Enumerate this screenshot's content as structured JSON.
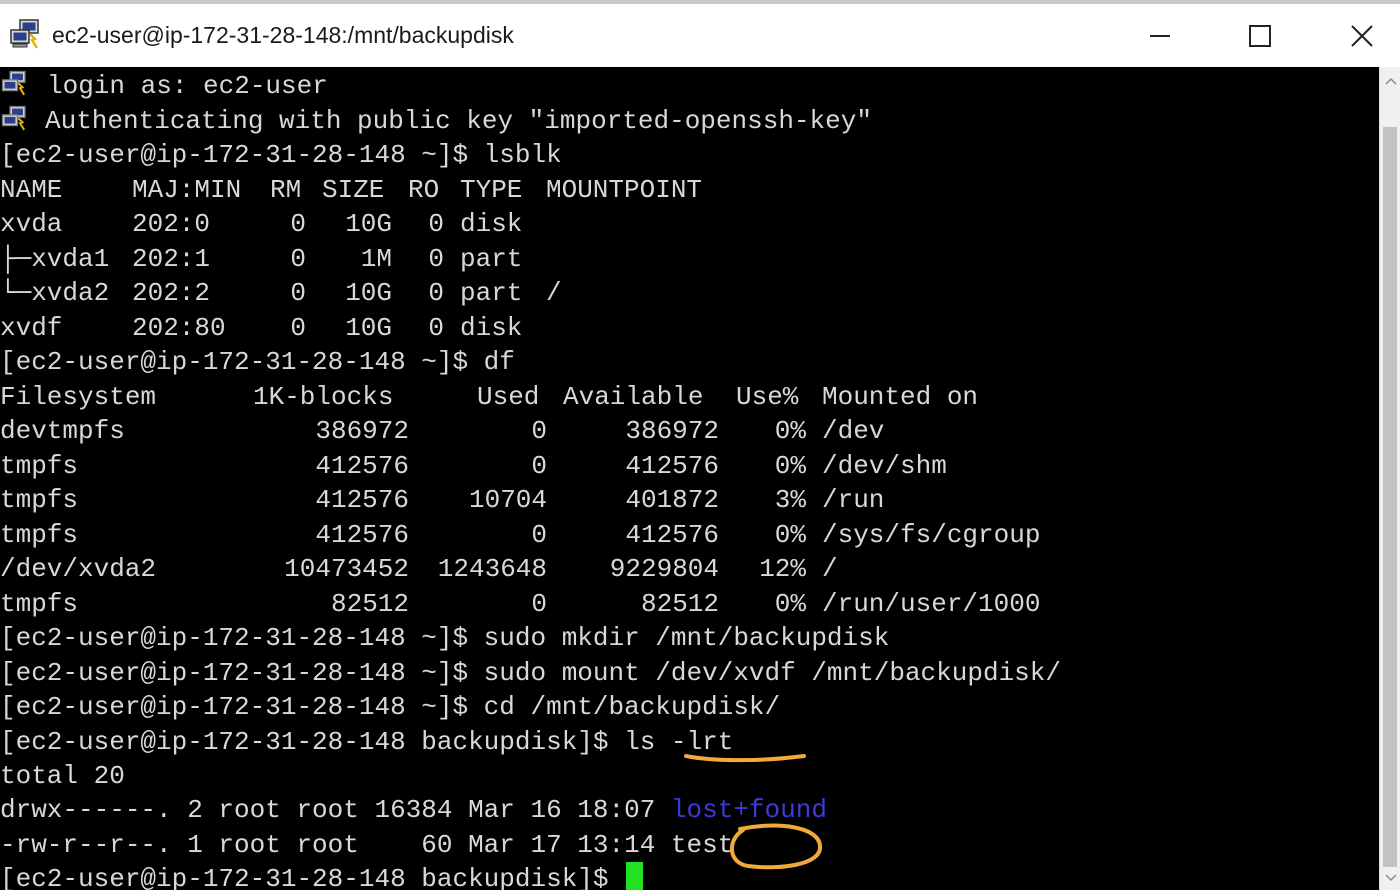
{
  "window": {
    "title": "ec2-user@ip-172-31-28-148:/mnt/backupdisk",
    "icon": "putty-computers-icon",
    "controls": [
      "minimize-icon",
      "maximize-icon",
      "close-icon"
    ]
  },
  "colors": {
    "terminal_bg": "#000000",
    "terminal_fg": "#d8d8d8",
    "directory": "#3b3bd6",
    "cursor": "#22e022",
    "annotation": "#f0a93a"
  },
  "terminal": {
    "login": {
      "login_text": "login as: ec2-user",
      "auth_text": "Authenticating with public key \"imported-openssh-key\""
    },
    "lsblk_cmd": "[ec2-user@ip-172-31-28-148 ~]$ lsblk",
    "lsblk": {
      "headers": [
        "NAME",
        "MAJ:MIN",
        "RM",
        "SIZE",
        "RO",
        "TYPE",
        "MOUNTPOINT"
      ],
      "rows": [
        [
          "xvda",
          "202:0",
          "0",
          "10G",
          "0",
          "disk",
          ""
        ],
        [
          "├─xvda1",
          "202:1",
          "0",
          "1M",
          "0",
          "part",
          ""
        ],
        [
          "└─xvda2",
          "202:2",
          "0",
          "10G",
          "0",
          "part",
          "/"
        ],
        [
          "xvdf",
          "202:80",
          "0",
          "10G",
          "0",
          "disk",
          ""
        ]
      ]
    },
    "df_cmd": "[ec2-user@ip-172-31-28-148 ~]$ df",
    "df": {
      "headers": [
        "Filesystem",
        "1K-blocks",
        "Used",
        "Available",
        "Use%",
        "Mounted on"
      ],
      "rows": [
        [
          "devtmpfs",
          "386972",
          "0",
          "386972",
          "0%",
          "/dev"
        ],
        [
          "tmpfs",
          "412576",
          "0",
          "412576",
          "0%",
          "/dev/shm"
        ],
        [
          "tmpfs",
          "412576",
          "10704",
          "401872",
          "3%",
          "/run"
        ],
        [
          "tmpfs",
          "412576",
          "0",
          "412576",
          "0%",
          "/sys/fs/cgroup"
        ],
        [
          "/dev/xvda2",
          "10473452",
          "1243648",
          "9229804",
          "12%",
          "/"
        ],
        [
          "tmpfs",
          "82512",
          "0",
          "82512",
          "0%",
          "/run/user/1000"
        ]
      ]
    },
    "mkdir_cmd": "[ec2-user@ip-172-31-28-148 ~]$ sudo mkdir /mnt/backupdisk",
    "mount_cmd": "[ec2-user@ip-172-31-28-148 ~]$ sudo mount /dev/xvdf /mnt/backupdisk/",
    "cd_cmd": "[ec2-user@ip-172-31-28-148 ~]$ cd /mnt/backupdisk/",
    "ls_prompt": "[ec2-user@ip-172-31-28-148 backupdisk]$ ",
    "ls_cmd": "ls -lrt",
    "total": "total 20",
    "ls": {
      "rows": [
        {
          "meta": "drwx------. 2 root root 16384 Mar 16 18:07 ",
          "name": "lost+found",
          "is_dir": true
        },
        {
          "meta": "-rw-r--r--. 1 root root    60 Mar 17 13:14 ",
          "name": "test",
          "is_dir": false
        }
      ]
    },
    "final_prompt": "[ec2-user@ip-172-31-28-148 backupdisk]$ "
  }
}
